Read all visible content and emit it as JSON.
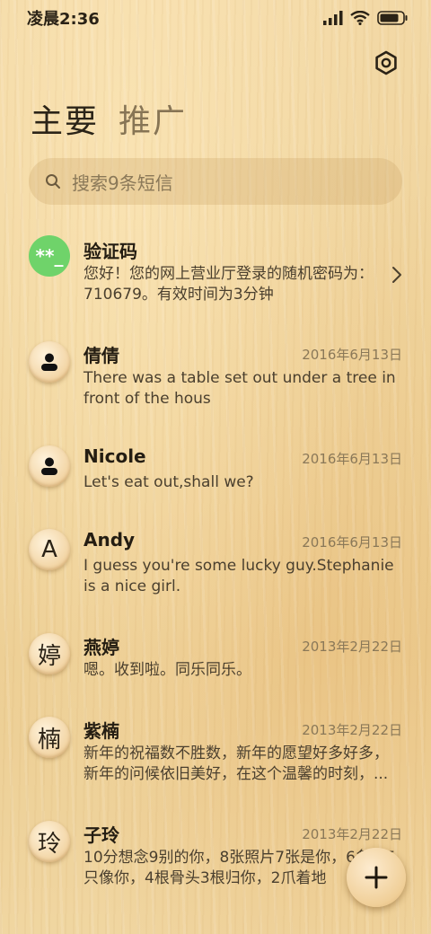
{
  "status_bar": {
    "time": "凌晨2:36"
  },
  "tabs": [
    {
      "label": "主要"
    },
    {
      "label": "推广"
    }
  ],
  "search": {
    "placeholder": "搜索9条短信"
  },
  "conversations": [
    {
      "avatar": "**_",
      "name": "验证码",
      "date": "",
      "preview": "您好！您的网上营业厅登录的随机密码为：710679。有效时间为3分钟"
    },
    {
      "avatar": "person-icon",
      "name": "倩倩",
      "date": "2016年6月13日",
      "preview": "There was a table set out under a tree in front of the hous"
    },
    {
      "avatar": "person-icon",
      "name": "Nicole",
      "date": "2016年6月13日",
      "preview": "Let's eat out,shall we?"
    },
    {
      "avatar": "A",
      "name": "Andy",
      "date": "2016年6月13日",
      "preview": "I guess you're some lucky guy.Stephanie is a nice girl."
    },
    {
      "avatar": "婷",
      "name": "燕婷",
      "date": "2013年2月22日",
      "preview": "嗯。收到啦。同乐同乐。"
    },
    {
      "avatar": "楠",
      "name": "紫楠",
      "date": "2013年2月22日",
      "preview": "新年的祝福数不胜数，新年的愿望好多好多，新年的问候依旧美好，在这个温馨的时刻，..."
    },
    {
      "avatar": "玲",
      "name": "子玲",
      "date": "2013年2月22日",
      "preview": "10分想念9别的你，8张照片7张是你，6条狗5只像你，4根骨头3根归你，2爪着地"
    }
  ]
}
